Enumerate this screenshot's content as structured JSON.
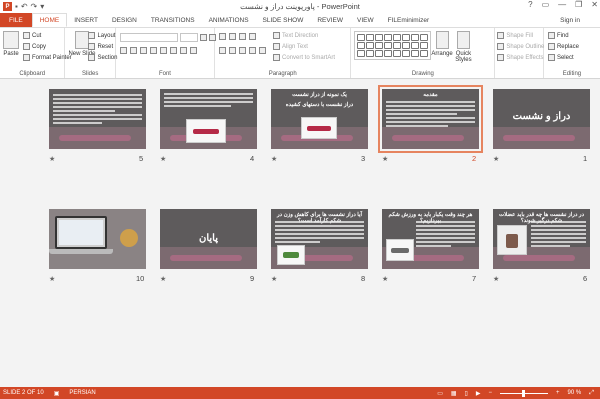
{
  "window": {
    "title": "پاورپوینت دراز و نشست - PowerPoint",
    "sign_in": "Sign in"
  },
  "qat": {
    "save_icon": "save-icon",
    "undo_icon": "undo-icon",
    "redo_icon": "redo-icon"
  },
  "tabs": [
    "FILE",
    "HOME",
    "INSERT",
    "DESIGN",
    "TRANSITIONS",
    "ANIMATIONS",
    "SLIDE SHOW",
    "REVIEW",
    "VIEW",
    "FILEminimizer"
  ],
  "ribbon": {
    "clipboard": {
      "label": "Clipboard",
      "paste": "Paste",
      "cut": "Cut",
      "copy": "Copy",
      "format_painter": "Format Painter"
    },
    "slides": {
      "label": "Slides",
      "new_slide": "New Slide",
      "layout": "Layout",
      "reset": "Reset",
      "section": "Section"
    },
    "font": {
      "label": "Font"
    },
    "paragraph": {
      "label": "Paragraph",
      "text_direction": "Text Direction",
      "align_text": "Align Text",
      "convert_smartart": "Convert to SmartArt"
    },
    "drawing": {
      "label": "Drawing",
      "arrange": "Arrange",
      "quick_styles": "Quick Styles",
      "shape_fill": "Shape Fill",
      "shape_outline": "Shape Outline",
      "shape_effects": "Shape Effects"
    },
    "editing": {
      "label": "Editing",
      "find": "Find",
      "replace": "Replace",
      "select": "Select"
    }
  },
  "slides": [
    {
      "n": "1",
      "title": "دراز و نشست",
      "kind": "title"
    },
    {
      "n": "2",
      "title": "مقدمه",
      "kind": "text",
      "selected": true
    },
    {
      "n": "3",
      "title": "یک نمونه از دراز نشست",
      "subtitle": "دراز نشست با دستهای کشیده",
      "kind": "image"
    },
    {
      "n": "4",
      "title": "",
      "kind": "textimage"
    },
    {
      "n": "5",
      "title": "",
      "kind": "text"
    },
    {
      "n": "6",
      "title": "در دراز نشست ها چه قدر باید عضلات شکم درگیر شوند؟",
      "kind": "sideimg"
    },
    {
      "n": "7",
      "title": "هر چند وقت یکبار باید به ورزش شکم بپردازیم؟",
      "kind": "sideimg2"
    },
    {
      "n": "8",
      "title": "آیا دراز نشست ها برای کاهش وزن در شکم کارآمد است؟",
      "kind": "textimg3"
    },
    {
      "n": "9",
      "title": "پایان",
      "kind": "title"
    },
    {
      "n": "10",
      "title": "",
      "kind": "laptop"
    }
  ],
  "status": {
    "slide": "SLIDE 2 OF 10",
    "language": "PERSIAN",
    "zoom": "90 %"
  }
}
